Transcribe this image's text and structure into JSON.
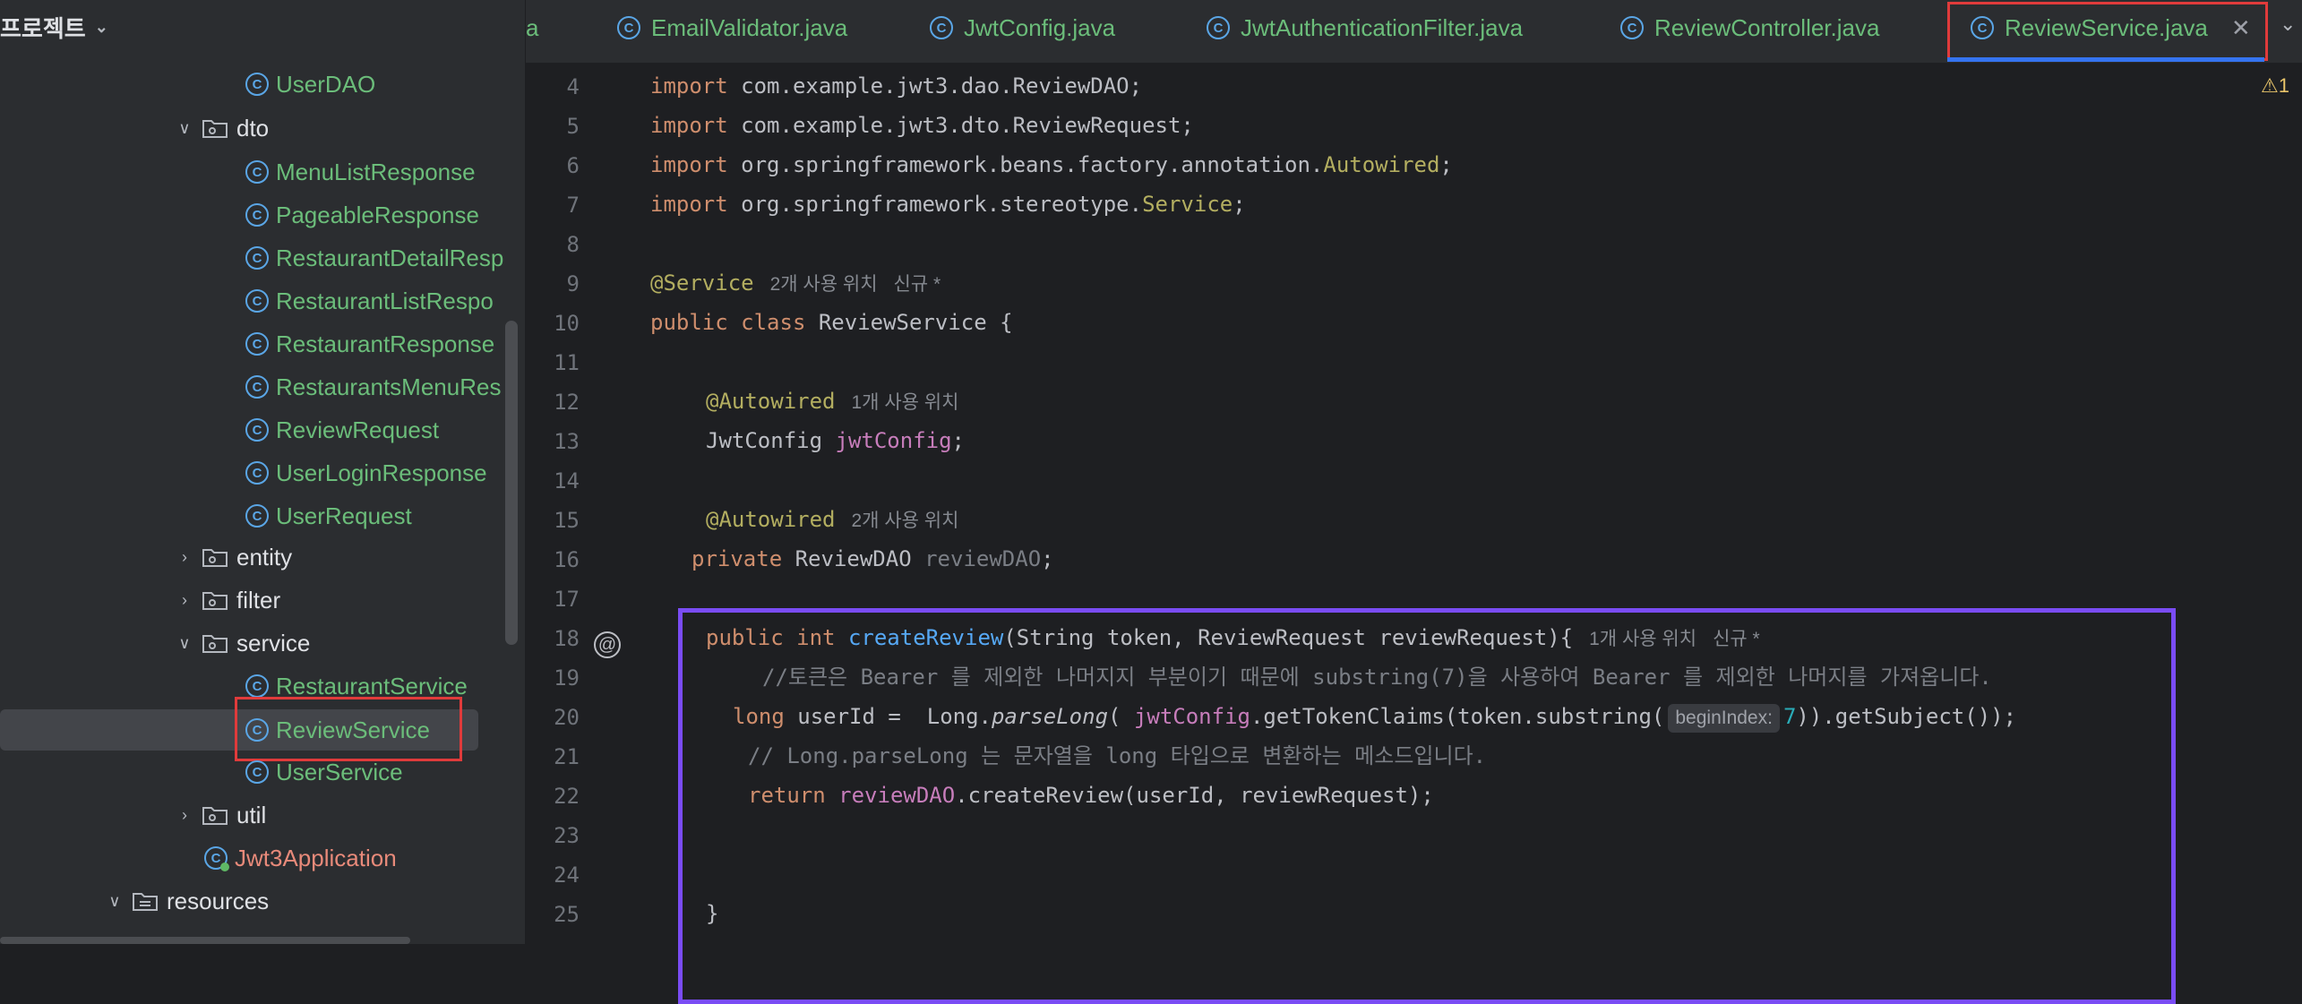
{
  "sidebar": {
    "project_title": "프로젝트",
    "items": [
      {
        "label": "UserDAO",
        "kind": "class"
      },
      {
        "label": "dto",
        "kind": "folder-open"
      },
      {
        "label": "MenuListResponse",
        "kind": "class"
      },
      {
        "label": "PageableResponse",
        "kind": "class"
      },
      {
        "label": "RestaurantDetailResp",
        "kind": "class"
      },
      {
        "label": "RestaurantListRespo",
        "kind": "class"
      },
      {
        "label": "RestaurantResponse",
        "kind": "class"
      },
      {
        "label": "RestaurantsMenuRes",
        "kind": "class"
      },
      {
        "label": "ReviewRequest",
        "kind": "class"
      },
      {
        "label": "UserLoginResponse",
        "kind": "class"
      },
      {
        "label": "UserRequest",
        "kind": "class"
      },
      {
        "label": "entity",
        "kind": "folder-closed"
      },
      {
        "label": "filter",
        "kind": "folder-closed"
      },
      {
        "label": "service",
        "kind": "folder-open"
      },
      {
        "label": "RestaurantService",
        "kind": "class"
      },
      {
        "label": "ReviewService",
        "kind": "class",
        "selected": true
      },
      {
        "label": "UserService",
        "kind": "class"
      },
      {
        "label": "util",
        "kind": "folder-closed"
      },
      {
        "label": "Jwt3Application",
        "kind": "app"
      },
      {
        "label": "resources",
        "kind": "resources"
      }
    ]
  },
  "tabs": [
    {
      "label": "a"
    },
    {
      "label": "EmailValidator.java"
    },
    {
      "label": "JwtConfig.java"
    },
    {
      "label": "JwtAuthenticationFilter.java"
    },
    {
      "label": "ReviewController.java"
    },
    {
      "label": "ReviewService.java",
      "active": true
    }
  ],
  "editor": {
    "warning": "1",
    "line_numbers": [
      "4",
      "5",
      "6",
      "7",
      "8",
      "9",
      "10",
      "11",
      "12",
      "13",
      "14",
      "15",
      "16",
      "17",
      "18",
      "19",
      "20",
      "21",
      "22",
      "23",
      "24",
      "25"
    ],
    "hints": {
      "service_usages": "2개 사용 위치",
      "service_new": "신규 *",
      "autowired1_usages": "1개 사용 위치",
      "autowired2_usages": "2개 사용 위치",
      "create_usages": "1개 사용 위치",
      "create_new": "신규 *",
      "param_begin_index": "beginIndex:"
    },
    "code": {
      "import1_kw": "import",
      "import1": " com.example.jwt3.dao.ReviewDAO;",
      "import2": " com.example.jwt3.dto.ReviewRequest;",
      "import3_a": " org.springframework.beans.factory.annotation.",
      "import3_b": "Autowired",
      "import4_a": " org.springframework.stereotype.",
      "import4_b": "Service",
      "ann_service": "@Service",
      "class_kw": "public class",
      "class_name": " ReviewService {",
      "ann_autowired": "@Autowired",
      "jwt_type": "JwtConfig ",
      "jwt_field": "jwtConfig",
      "private_kw": "private",
      "dao_type": " ReviewDAO ",
      "dao_field": "reviewDAO",
      "method_kw": "public int ",
      "method_name": "createReview",
      "method_params": "(String token, ReviewRequest reviewRequest){",
      "comment1": "//토큰은 Bearer 를 제외한 나머지지 부분이기 때문에 substring(7)을 사용하여 Bearer 를 제외한 나머지를 가져옵니다.",
      "long_kw": "long",
      "userid_a": " userId =  Long.",
      "parse_long": "parseLong",
      "userid_b": "( ",
      "userid_c": ".getTokenClaims(token.substring(",
      "seven": "7",
      "userid_d": ")).getSubject());",
      "comment2": "// Long.parseLong 는 문자열을 long 타입으로 변환하는 메소드입니다.",
      "return_kw": "return",
      "return_b": ".createReview(userId, reviewRequest);",
      "close_brace": "}"
    }
  }
}
